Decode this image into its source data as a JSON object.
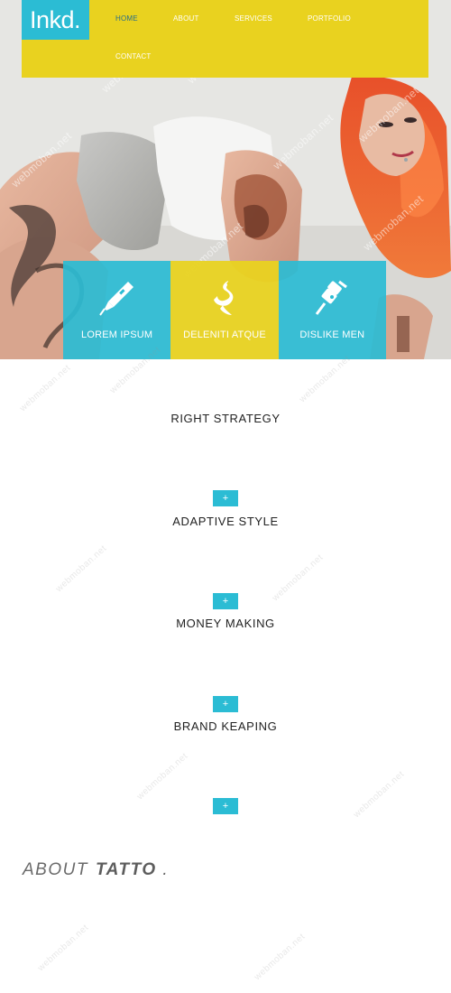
{
  "brand": {
    "logo_text": "Inkd."
  },
  "nav": {
    "items": [
      {
        "label": "HOME",
        "active": true
      },
      {
        "label": "ABOUT",
        "active": false
      },
      {
        "label": "SERVICES",
        "active": false
      },
      {
        "label": "PORTFOLIO",
        "active": false
      },
      {
        "label": "CONTACT",
        "active": false
      }
    ]
  },
  "hero": {
    "tiles": [
      {
        "label": "LOREM IPSUM",
        "icon": "tattoo-pen-icon",
        "color": "#2bbcd4"
      },
      {
        "label": "DELENITI ATQUE",
        "icon": "dragon-icon",
        "color": "#e9d21f"
      },
      {
        "label": "DISLIKE MEN",
        "icon": "tattoo-machine-icon",
        "color": "#2bbcd4"
      }
    ]
  },
  "features": [
    {
      "title": "RIGHT STRATEGY"
    },
    {
      "title": "ADAPTIVE STYLE"
    },
    {
      "title": "MONEY MAKING"
    },
    {
      "title": "BRAND KEAPING"
    }
  ],
  "plus_symbol": "+",
  "about": {
    "prefix": "ABOUT",
    "emphasis": "TATTO",
    "suffix": " ."
  },
  "watermark_text": "webmoban.net",
  "colors": {
    "accent_blue": "#2bbcd4",
    "accent_yellow": "#e9d21f"
  }
}
